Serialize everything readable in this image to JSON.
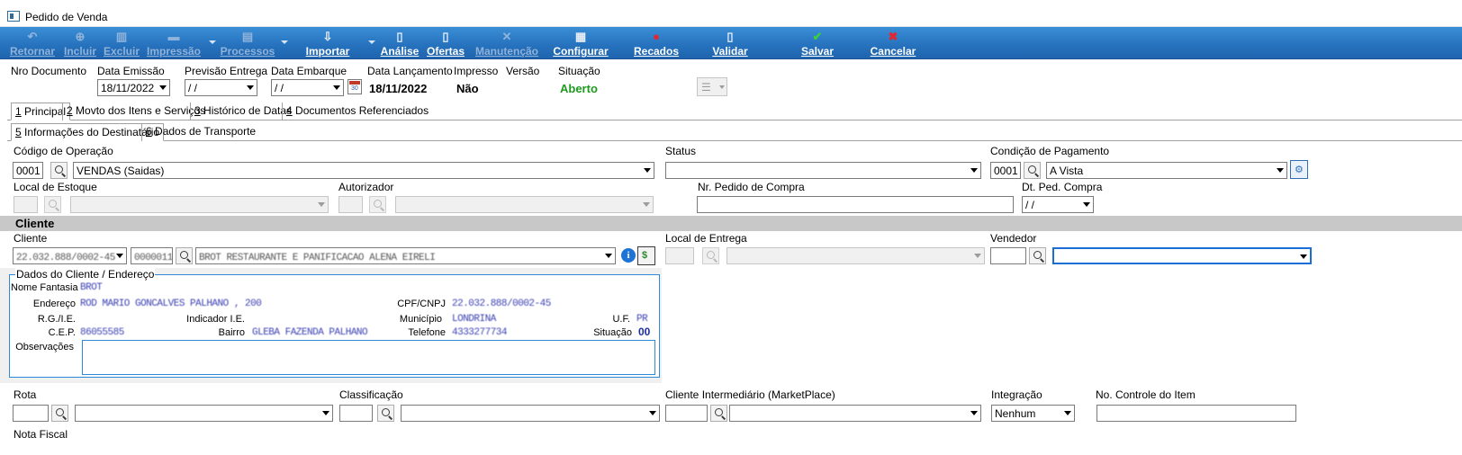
{
  "window": {
    "title": "Pedido de Venda"
  },
  "toolbar": {
    "retornar": "Retornar",
    "incluir": "Incluir",
    "excluir": "Excluir",
    "impressao": "Impressão",
    "processos": "Processos",
    "importar": "Importar",
    "analise": "Análise",
    "ofertas": "Ofertas",
    "manutencao": "Manutenção",
    "configurar": "Configurar",
    "recados": "Recados",
    "validar": "Validar",
    "salvar": "Salvar",
    "cancelar": "Cancelar"
  },
  "header": {
    "nro_documento_label": "Nro Documento",
    "data_emissao_label": "Data Emissão",
    "data_emissao_value": "18/11/2022",
    "previsao_entrega_label": "Previsão Entrega",
    "previsao_entrega_value": " / /",
    "data_embarque_label": "Data Embarque",
    "data_embarque_value": " / /",
    "data_lancamento_label": "Data Lançamento",
    "data_lancamento_value": "18/11/2022",
    "impresso_label": "Impresso",
    "impresso_value": "Não",
    "versao_label": "Versão",
    "situacao_label": "Situação",
    "situacao_value": "Aberto",
    "situacao_color": "#1e9a1e"
  },
  "tabs": {
    "main": [
      {
        "num": "1",
        "label": " Principal"
      },
      {
        "num": "2",
        "label": " Movto dos Itens e Serviços"
      },
      {
        "num": "3",
        "label": " Histórico de Datas"
      },
      {
        "num": "4",
        "label": " Documentos Referenciados"
      }
    ],
    "sub": [
      {
        "num": "5",
        "label": " Informações do Destinatário"
      },
      {
        "num": "6",
        "label": " Dados de Transporte"
      }
    ]
  },
  "form": {
    "codigo_operacao_label": "Código de Operação",
    "codigo_operacao_code": "0001",
    "codigo_operacao_desc": "VENDAS (Saidas)",
    "status_label": "Status",
    "condicao_pagamento_label": "Condição de Pagamento",
    "condicao_pagamento_code": "0001",
    "condicao_pagamento_desc": "A Vista",
    "local_estoque_label": "Local de Estoque",
    "autorizador_label": "Autorizador",
    "nr_pedido_compra_label": "Nr. Pedido de Compra",
    "dt_ped_compra_label": "Dt. Ped. Compra",
    "dt_ped_compra_value": " / /",
    "cliente_section": "Cliente",
    "cliente_label": "Cliente",
    "cliente_doc": "22.032.888/0002-45",
    "cliente_code": "0000011",
    "cliente_name": "BROT RESTAURANTE E PANIFICACAO ALENA EIRELI",
    "local_entrega_label": "Local de Entrega",
    "vendedor_label": "Vendedor",
    "rota_label": "Rota",
    "classificacao_label": "Classificação",
    "cliente_intermediario_label": "Cliente Intermediário (MarketPlace)",
    "integracao_label": "Integração",
    "integracao_value": "Nenhum",
    "no_controle_item_label": "No. Controle do Item",
    "nota_fiscal_label": "Nota Fiscal"
  },
  "dados_cliente": {
    "title": "Dados do Cliente / Endereço",
    "nome_fantasia_label": "Nome Fantasia",
    "nome_fantasia_value": "BROT",
    "endereco_label": "Endereço",
    "endereco_value": "ROD MARIO GONCALVES PALHANO , 200",
    "cpf_cnpj_label": "CPF/CNPJ",
    "cpf_cnpj_value": "22.032.888/0002-45",
    "rg_ie_label": "R.G./I.E.",
    "indicador_ie_label": "Indicador I.E.",
    "municipio_label": "Município",
    "municipio_value": "LONDRINA",
    "uf_label": "U.F.",
    "uf_value": "PR",
    "cep_label": "C.E.P.",
    "cep_value": "86055585",
    "bairro_label": "Bairro",
    "bairro_value": "GLEBA FAZENDA PALHANO",
    "telefone_label": "Telefone",
    "telefone_value": "4333277734",
    "situacao_label": "Situação",
    "situacao_value": "00",
    "observacoes_label": "Observações"
  }
}
